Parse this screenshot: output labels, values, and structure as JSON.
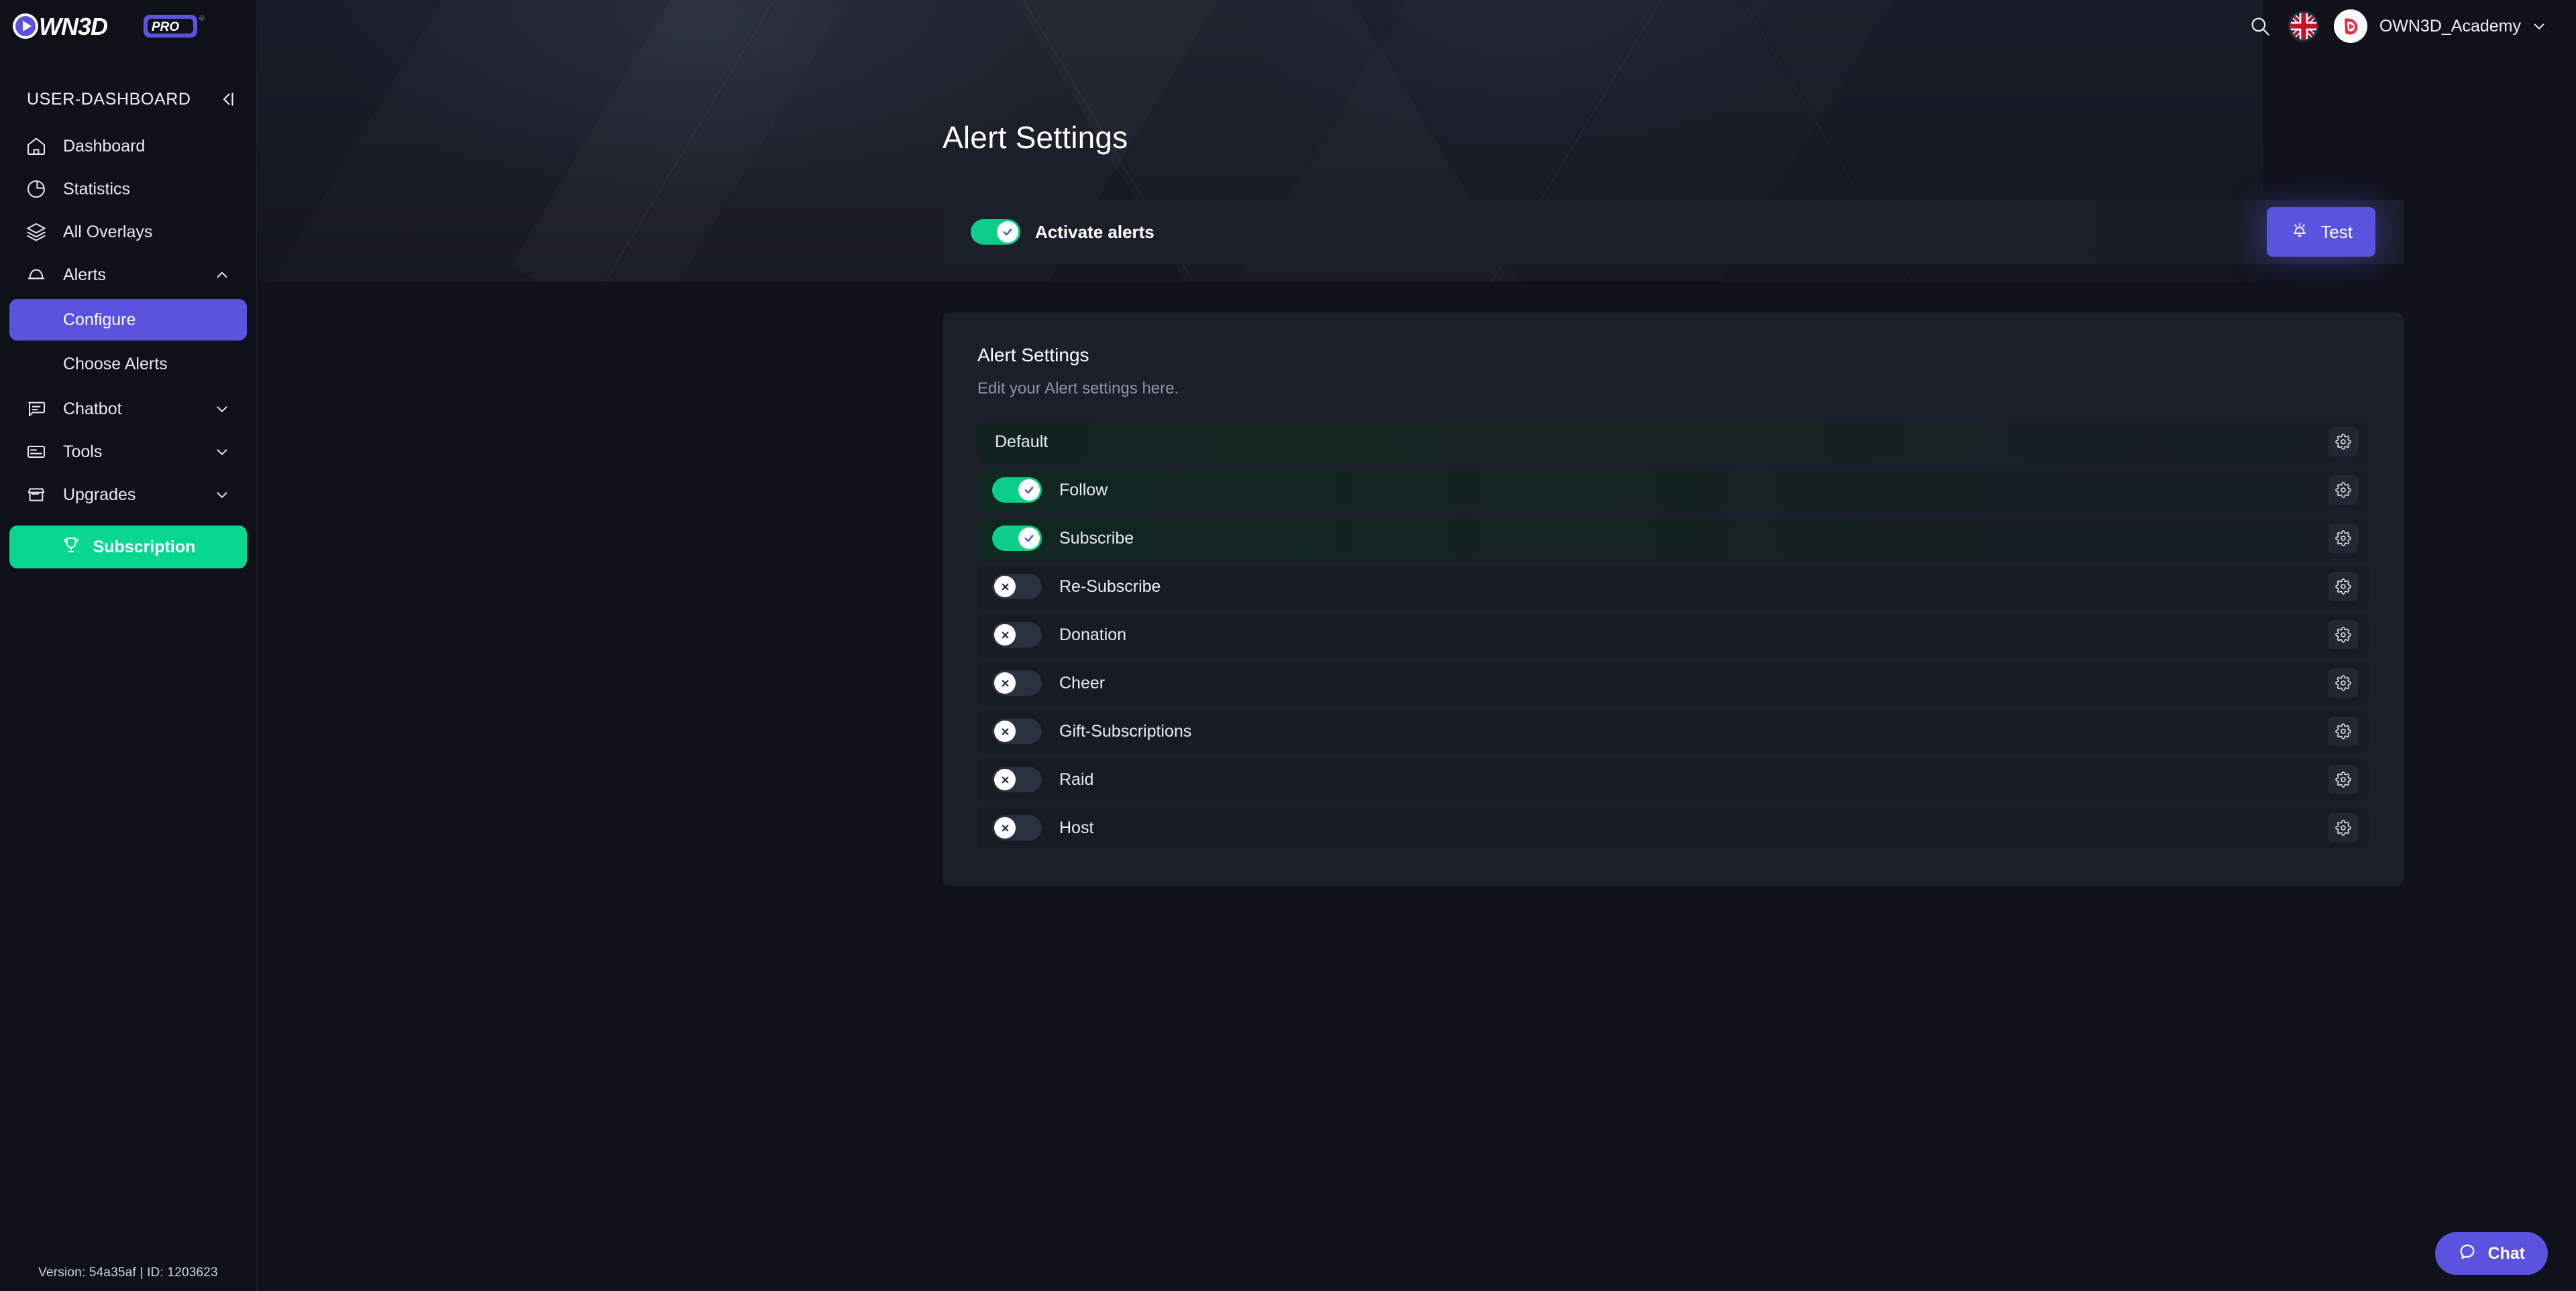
{
  "brand": {
    "logo_text": "OWN3D",
    "logo_badge": "PRO",
    "trademark": "®"
  },
  "sidebar": {
    "section_title": "USER-DASHBOARD",
    "collapse_icon": "collapse-left-icon",
    "items": [
      {
        "label": "Dashboard",
        "icon": "home-icon",
        "expandable": false,
        "active": false
      },
      {
        "label": "Statistics",
        "icon": "pie-chart-icon",
        "expandable": false,
        "active": false
      },
      {
        "label": "All Overlays",
        "icon": "layers-icon",
        "expandable": false,
        "active": false
      },
      {
        "label": "Alerts",
        "icon": "alert-icon",
        "expandable": true,
        "expanded": true,
        "chevron": "chevron-up-icon"
      },
      {
        "label": "Chatbot",
        "icon": "chat-icon",
        "expandable": true,
        "expanded": false,
        "chevron": "chevron-down-icon"
      },
      {
        "label": "Tools",
        "icon": "tools-icon",
        "expandable": true,
        "expanded": false,
        "chevron": "chevron-down-icon"
      },
      {
        "label": "Upgrades",
        "icon": "store-icon",
        "expandable": true,
        "expanded": false,
        "chevron": "chevron-down-icon"
      }
    ],
    "alerts_sub_items": [
      {
        "label": "Configure",
        "active": true
      },
      {
        "label": "Choose Alerts",
        "active": false
      }
    ],
    "subscription_button": {
      "label": "Subscription",
      "icon": "trophy-icon",
      "color": "#07d78f"
    },
    "version_text": "Version: 54a35af | ID: 1203623"
  },
  "topbar": {
    "search_icon": "search-icon",
    "language_flag": "uk-flag-icon",
    "user_name": "OWN3D_Academy",
    "user_chevron": "chevron-down-icon",
    "avatar_icon": "own3d-play-avatar"
  },
  "hero": {
    "page_title": "Alert Settings"
  },
  "activate_bar": {
    "toggle_label": "Activate alerts",
    "toggle_on": true,
    "test_button": {
      "label": "Test",
      "icon": "bell-ring-icon",
      "color": "#5b52e0"
    }
  },
  "card": {
    "title": "Alert Settings",
    "subtitle": "Edit your Alert settings here.",
    "rows": [
      {
        "label": "Default",
        "kind": "header",
        "enabled": null,
        "gear": "gear-icon"
      },
      {
        "label": "Follow",
        "kind": "alert",
        "enabled": true,
        "gear": "gear-icon"
      },
      {
        "label": "Subscribe",
        "kind": "alert",
        "enabled": true,
        "gear": "gear-icon"
      },
      {
        "label": "Re-Subscribe",
        "kind": "alert",
        "enabled": false,
        "gear": "gear-icon"
      },
      {
        "label": "Donation",
        "kind": "alert",
        "enabled": false,
        "gear": "gear-icon"
      },
      {
        "label": "Cheer",
        "kind": "alert",
        "enabled": false,
        "gear": "gear-icon"
      },
      {
        "label": "Gift-Subscriptions",
        "kind": "alert",
        "enabled": false,
        "gear": "gear-icon"
      },
      {
        "label": "Raid",
        "kind": "alert",
        "enabled": false,
        "gear": "gear-icon"
      },
      {
        "label": "Host",
        "kind": "alert",
        "enabled": false,
        "gear": "gear-icon"
      }
    ]
  },
  "chat_widget": {
    "label": "Chat",
    "icon": "chat-bubble-icon",
    "color": "#5b52e0"
  },
  "colors": {
    "accent_purple": "#5b52e0",
    "accent_green": "#07d78f",
    "toggle_on": "#0bce89",
    "toggle_off": "#2b3040",
    "bg": "#0f1219",
    "sidebar_bg": "#0e1118",
    "card_bg": "#1b1f2a",
    "row_bg": "#171b24"
  }
}
